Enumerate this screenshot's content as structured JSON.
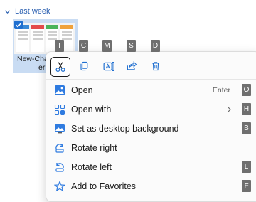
{
  "group": {
    "label": "Last week",
    "icon": "chevron-down-icon"
  },
  "file": {
    "name_line1": "New-Cha",
    "name_line2": "er",
    "selected": true,
    "thumbnail_icon": "image-thumbnail"
  },
  "quick_actions": [
    {
      "name": "cut",
      "icon": "scissors-icon",
      "key": "T",
      "active": true
    },
    {
      "name": "copy",
      "icon": "copy-icon",
      "key": "C",
      "active": false
    },
    {
      "name": "rename",
      "icon": "rename-icon",
      "key": "M",
      "active": false
    },
    {
      "name": "share",
      "icon": "share-icon",
      "key": "S",
      "active": false
    },
    {
      "name": "delete",
      "icon": "trash-icon",
      "key": "D",
      "active": false
    }
  ],
  "menu_items": [
    {
      "label": "Open",
      "hint": "Enter",
      "key": "O",
      "icon": "open-image-icon"
    },
    {
      "label": "Open with",
      "hint": "",
      "key": "H",
      "icon": "open-with-icon",
      "submenu": true
    },
    {
      "label": "Set as desktop background",
      "hint": "",
      "key": "B",
      "icon": "desktop-background-icon"
    },
    {
      "label": "Rotate right",
      "hint": "",
      "key": "",
      "icon": "rotate-right-icon"
    },
    {
      "label": "Rotate left",
      "hint": "",
      "key": "L",
      "icon": "rotate-left-icon"
    },
    {
      "label": "Add to Favorites",
      "hint": "",
      "key": "F",
      "icon": "star-icon"
    }
  ],
  "colors": {
    "accent": "#1f6fd0",
    "keytip_bg": "#6f6f6f",
    "selection_tile": "#c9dcf3"
  }
}
